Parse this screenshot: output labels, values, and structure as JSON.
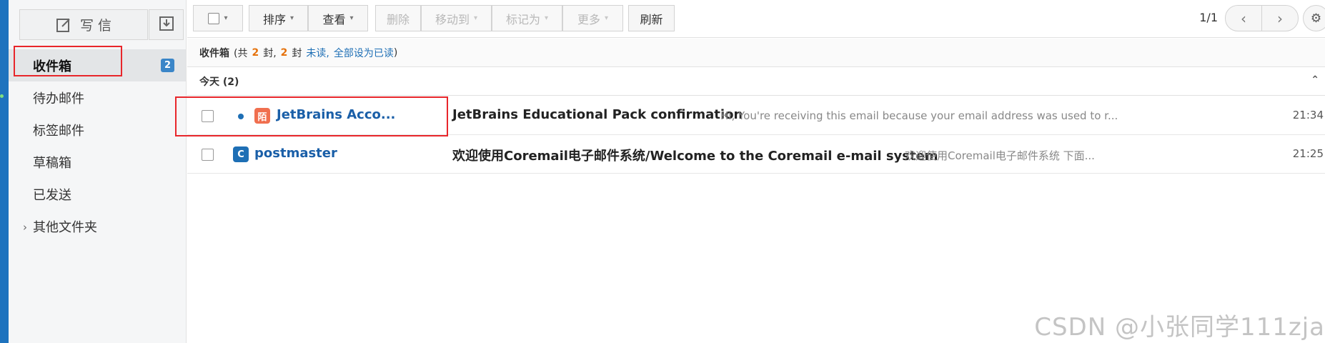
{
  "sidebar": {
    "compose_label": "写 信",
    "compose_icon": "compose-icon",
    "receive_icon": "inbox-download-icon",
    "folders": [
      {
        "label": "收件箱",
        "badge": "2"
      },
      {
        "label": "待办邮件"
      },
      {
        "label": "标签邮件"
      },
      {
        "label": "草稿箱"
      },
      {
        "label": "已发送"
      },
      {
        "label": "其他文件夹",
        "icon": "chevron-right-icon"
      }
    ]
  },
  "toolbar": {
    "sort": "排序",
    "view": "查看",
    "delete": "删除",
    "move": "移动到",
    "mark": "标记为",
    "more": "更多",
    "refresh": "刷新",
    "page_info": "1/1",
    "prev_icon": "chevron-left-icon",
    "next_icon": "chevron-right-icon",
    "settings_icon": "gear-icon"
  },
  "info": {
    "folder": "收件箱",
    "open_paren": "(共",
    "total": "2",
    "mid": "封,",
    "unread": "2",
    "mid2": "封",
    "unread_label": "未读,",
    "mark_all": "全部设为已读",
    "close_paren": ")"
  },
  "group": {
    "label": "今天 (2)",
    "collapse_icon": "double-chevron-up-icon"
  },
  "mails": [
    {
      "sender": "JetBrains Acco...",
      "avatar": "陌",
      "avatar_color": "#f06f4f",
      "subject": "JetBrains Educational Pack confirmation",
      "preview": "Hi, You're receiving this email because your email address was used to r...",
      "time": "21:34",
      "unread": true
    },
    {
      "sender": "postmaster",
      "avatar": "C",
      "avatar_color": "#1e6fb5",
      "subject": "欢迎使用Coremail电子邮件系统/Welcome to the Coremail e-mail system",
      "preview": "欢迎使用Coremail电子邮件系统 下面...",
      "time": "21:25",
      "unread": false
    }
  ],
  "watermark": "CSDN @小张同学111zja",
  "colors": {
    "accent": "#1e6fb5",
    "highlight_box": "#e8262b",
    "count": "#e5720c"
  }
}
